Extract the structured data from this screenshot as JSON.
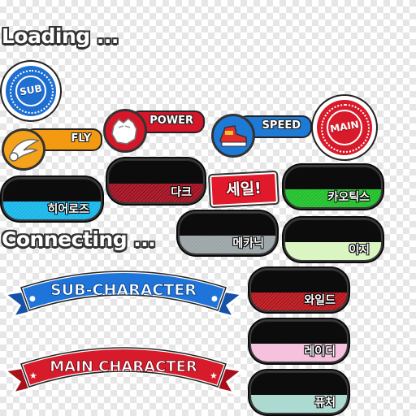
{
  "status": {
    "loading": "Loading ...",
    "connecting": "Connecting ..."
  },
  "emblems": {
    "sub": "SUB",
    "main": "MAIN"
  },
  "tags": [
    {
      "id": "fly",
      "label": "FLY",
      "color": "#f39a12"
    },
    {
      "id": "power",
      "label": "POWER",
      "color": "#d6172a"
    },
    {
      "id": "speed",
      "label": "SPEED",
      "color": "#1d7ad6"
    }
  ],
  "banners": {
    "sub_character": "SUB-CHARACTER",
    "main_character": "MAIN CHARACTER"
  },
  "sale_badge": "세일!",
  "character_types": [
    {
      "id": "dark",
      "label": "다크",
      "color": "#a01020"
    },
    {
      "id": "heroes",
      "label": "히어로즈",
      "color": "#18b6ea"
    },
    {
      "id": "chaotix",
      "label": "카오틱스",
      "color": "#20c02a"
    },
    {
      "id": "mechanic",
      "label": "메카닉",
      "color": "#9aa3a6"
    },
    {
      "id": "easy",
      "label": "이지",
      "color": "#d8f5bf"
    },
    {
      "id": "wild",
      "label": "와일드",
      "color": "#b4161c"
    },
    {
      "id": "lady",
      "label": "레이디",
      "color": "#f5bedc"
    },
    {
      "id": "future",
      "label": "퓨처",
      "color": "#a8d8cf"
    }
  ]
}
